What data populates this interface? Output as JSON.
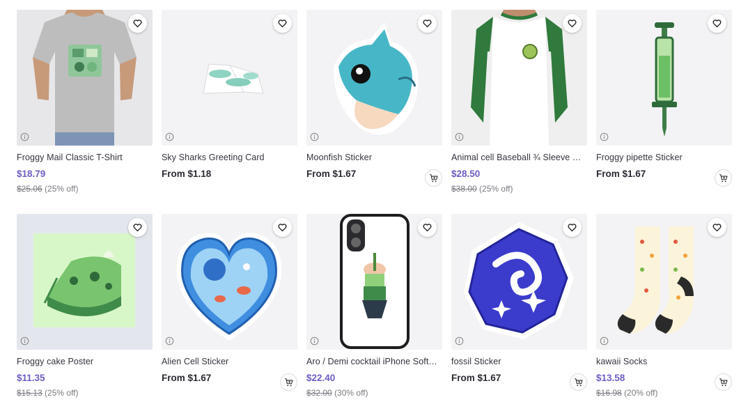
{
  "products": [
    {
      "title": "Froggy Mail Classic T-Shirt",
      "price": "$18.79",
      "original_price": "$25.06",
      "discount": "(25% off)",
      "sale": true,
      "has_cart": false,
      "image": "gray-tshirt-frog-print"
    },
    {
      "title": "Sky Sharks Greeting Card",
      "price": "From $1.18",
      "sale": false,
      "has_cart": false,
      "image": "greeting-card-sharks"
    },
    {
      "title": "Moonfish Sticker",
      "price": "From $1.67",
      "sale": false,
      "has_cart": true,
      "image": "moonfish-sticker"
    },
    {
      "title": "Animal cell Baseball ¾ Sleeve T-...",
      "price": "$28.50",
      "original_price": "$38.00",
      "discount": "(25% off)",
      "sale": true,
      "has_cart": false,
      "image": "baseball-tee-green-sleeves"
    },
    {
      "title": "Froggy pipette Sticker",
      "price": "From $1.67",
      "sale": false,
      "has_cart": true,
      "image": "pipette-sticker"
    },
    {
      "title": "Froggy cake Poster",
      "price": "$11.35",
      "original_price": "$15.13",
      "discount": "(25% off)",
      "sale": true,
      "has_cart": false,
      "image": "cake-poster"
    },
    {
      "title": "Alien Cell Sticker",
      "price": "From $1.67",
      "sale": false,
      "has_cart": true,
      "image": "heart-cell-sticker"
    },
    {
      "title": "Aro / Demi cocktail iPhone Soft C...",
      "price": "$22.40",
      "original_price": "$32.00",
      "discount": "(30% off)",
      "sale": true,
      "has_cart": false,
      "image": "iphone-case-cocktail"
    },
    {
      "title": "fossil Sticker",
      "price": "From $1.67",
      "sale": false,
      "has_cart": true,
      "image": "fossil-sticker"
    },
    {
      "title": "kawaii Socks",
      "price": "$13.58",
      "original_price": "$16.98",
      "discount": "(20% off)",
      "sale": true,
      "has_cart": true,
      "image": "fruit-socks"
    }
  ],
  "icons": {
    "favorite": "heart-icon",
    "info": "info-icon",
    "add_to_cart": "cart-add-icon"
  },
  "colors": {
    "sale_price": "#6c5ec4",
    "regular_price": "#2a2a33",
    "muted": "#7a7a82",
    "image_bg": "#f2f2f4"
  }
}
